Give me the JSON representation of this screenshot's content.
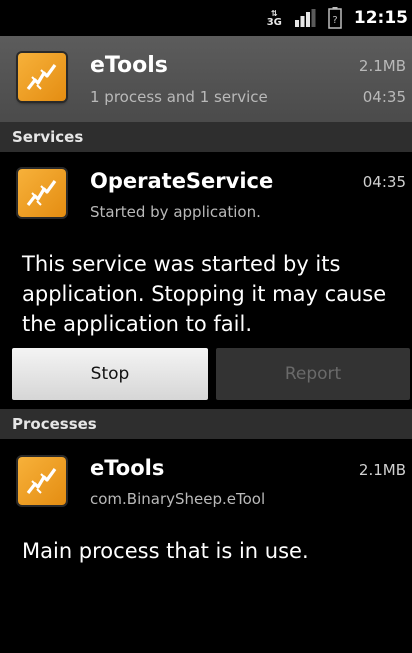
{
  "status_bar": {
    "network": "3G",
    "clock": "12:15",
    "icons": [
      "data-activity-icon",
      "signal-strength-icon",
      "battery-unknown-icon"
    ]
  },
  "app": {
    "name": "eTools",
    "summary": "1 process and 1 service",
    "size": "2.1MB",
    "time": "04:35",
    "icon": "etools-app-icon"
  },
  "services": {
    "header": "Services",
    "item": {
      "name": "OperateService",
      "subtitle": "Started by application.",
      "time": "04:35"
    },
    "description": "This service was started by its application. Stopping it may cause the application to fail.",
    "buttons": {
      "stop": "Stop",
      "report": "Report"
    }
  },
  "processes": {
    "header": "Processes",
    "item": {
      "name": "eTools",
      "package": "com.BinarySheep.eTool",
      "size": "2.1MB"
    },
    "description": "Main process that is in use."
  },
  "colors": {
    "icon_orange": "#f2a22c",
    "section_bg": "#2e2e2e",
    "header_bg": "#555555"
  }
}
